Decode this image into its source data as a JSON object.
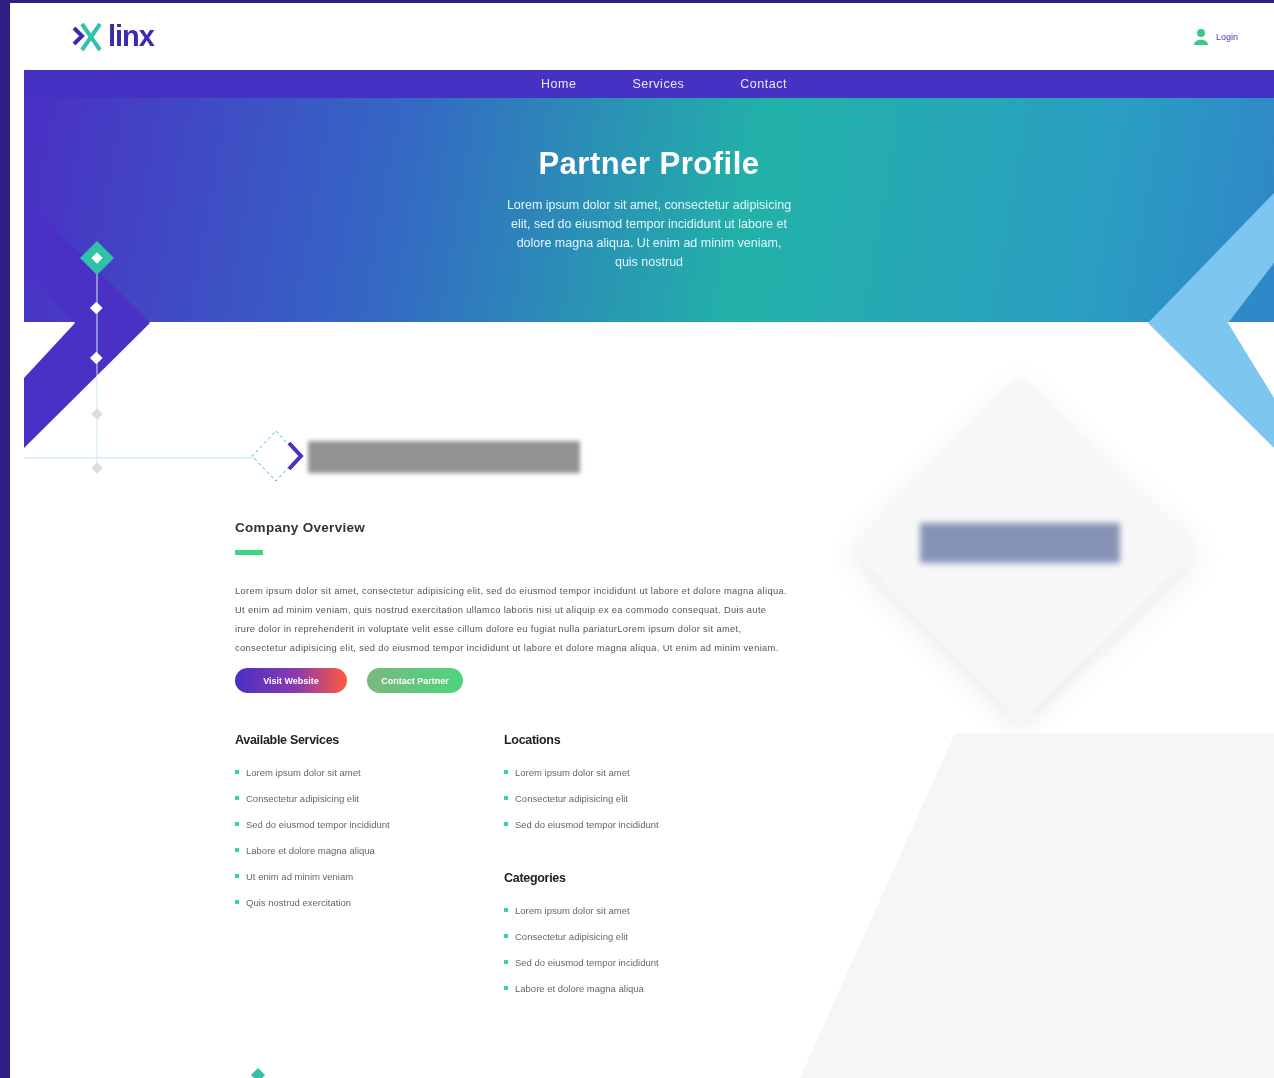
{
  "header": {
    "logo": "linx",
    "login": "Login"
  },
  "nav": [
    "Home",
    "Services",
    "Contact"
  ],
  "hero": {
    "title": "Partner Profile",
    "text": "Lorem ipsum dolor sit amet, consectetur adipisicing elit, sed do eiusmod tempor incididunt ut labore et dolore magna aliqua. Ut enim ad minim veniam, quis nostrud"
  },
  "overview": {
    "title": "Company Overview",
    "text": "Lorem ipsum dolor sit amet, consectetur adipisicing elit, sed do eiusmod tempor incididunt ut labore et dolore magna aliqua. Ut enim ad minim veniam, quis nostrud exercitation ullamco laboris nisi ut aliquip ex ea commodo consequat. Duis aute irure dolor in reprehenderit in voluptate velit esse cillum dolore eu fugiat nulla pariaturLorem ipsum dolor sit amet, consectetur adipisicing elit, sed do eiusmod tempor incididunt ut labore et dolore magna aliqua. Ut enim ad minim veniam.",
    "buttons": [
      {
        "label": "Visit Website",
        "kind": "primary"
      },
      {
        "label": "Contact Partner",
        "kind": "secondary"
      }
    ]
  },
  "services": {
    "title": "Available Services",
    "items": [
      "Lorem ipsum dolor sit amet",
      "Consectetur adipisicing elit",
      "Sed do eiusmod tempor incididunt",
      "Labore et dolore magna aliqua",
      "Ut enim ad minim veniam",
      "Quis nostrud exercitation"
    ]
  },
  "locations": {
    "title": "Locations",
    "items": [
      "Lorem ipsum dolor sit amet",
      "Consectetur adipisicing elit",
      "Sed do eiusmod tempor incididunt"
    ]
  },
  "categories": {
    "title": "Categories",
    "items": [
      "Lorem ipsum dolor sit amet",
      "Consectetur adipisicing elit",
      "Sed do eiusmod tempor incididunt",
      "Labore et dolore magna aliqua"
    ]
  }
}
